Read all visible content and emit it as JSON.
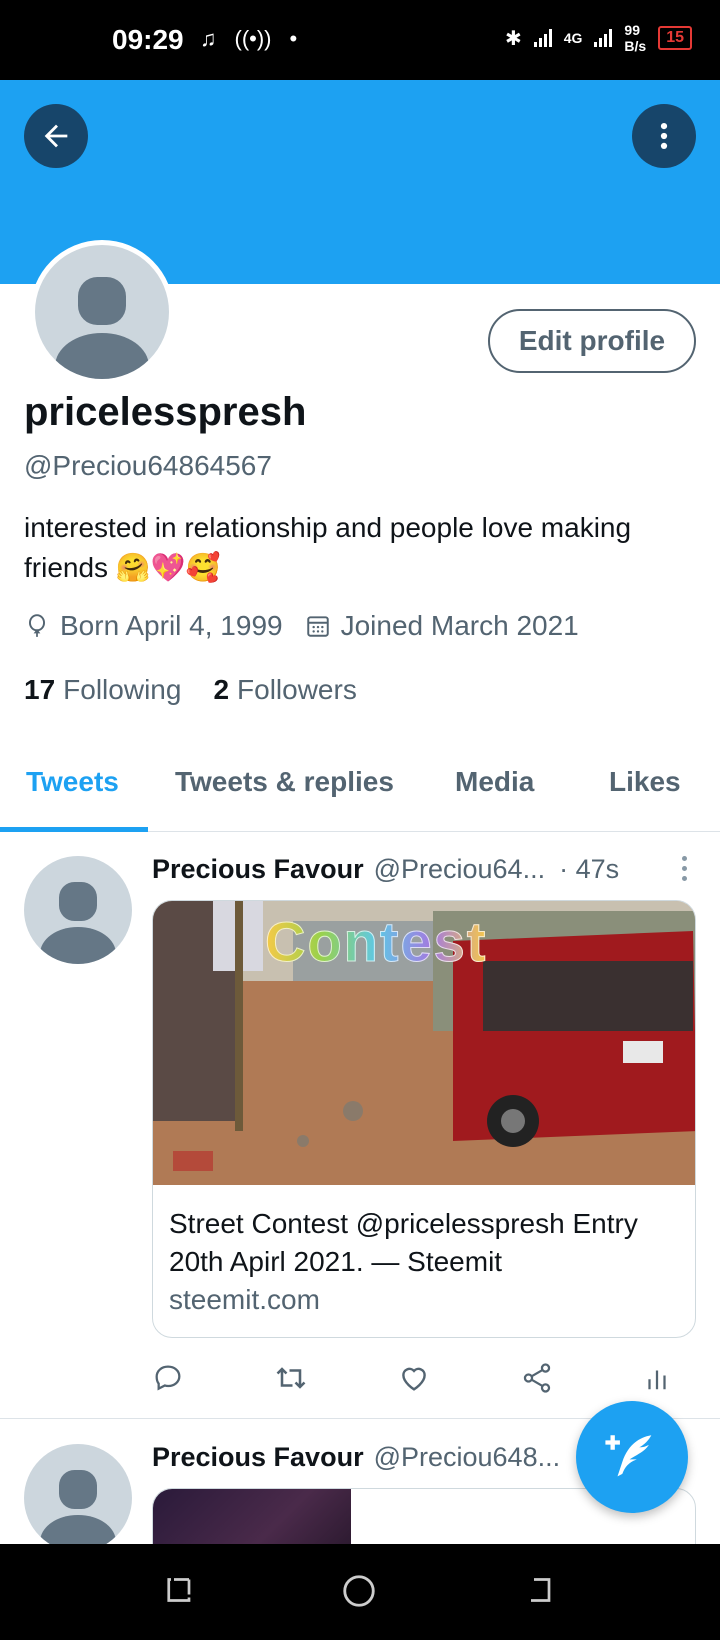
{
  "status_bar": {
    "time": "09:29",
    "network_type": "4G",
    "net_speed_value": "99",
    "net_speed_unit": "B/s",
    "battery": "15"
  },
  "profile": {
    "display_name": "pricelesspresh",
    "handle": "@Preciou64864567",
    "bio_text": "interested in relationship and people love making friends",
    "bio_emoji": "🤗💖🥰",
    "born": "Born April 4, 1999",
    "joined": "Joined March 2021",
    "following_count": "17",
    "following_label": "Following",
    "followers_count": "2",
    "followers_label": "Followers",
    "edit_button_label": "Edit profile"
  },
  "tabs": [
    {
      "label": "Tweets",
      "active": true
    },
    {
      "label": "Tweets & replies",
      "active": false
    },
    {
      "label": "Media",
      "active": false
    },
    {
      "label": "Likes",
      "active": false
    }
  ],
  "tweets": [
    {
      "name": "Precious Favour",
      "handle": "@Preciou64...",
      "time": "· 47s",
      "card_image_text": "Contest",
      "card_title": "Street Contest @pricelesspresh Entry 20th Apirl 2021. — Steemit",
      "card_domain": "steemit.com"
    },
    {
      "name": "Precious Favour",
      "handle": "@Preciou648..."
    }
  ],
  "colors": {
    "accent": "#1da1f2",
    "banner": "#1da1f2",
    "button_dark": "#17456a",
    "muted_text": "#536471"
  },
  "icons": {
    "back": "arrow-left-icon",
    "more": "more-vertical-icon",
    "birthday": "balloon-icon",
    "calendar": "calendar-icon",
    "reply": "reply-icon",
    "retweet": "retweet-icon",
    "like": "heart-icon",
    "share": "share-icon",
    "analytics": "analytics-icon",
    "compose": "feather-icon"
  }
}
